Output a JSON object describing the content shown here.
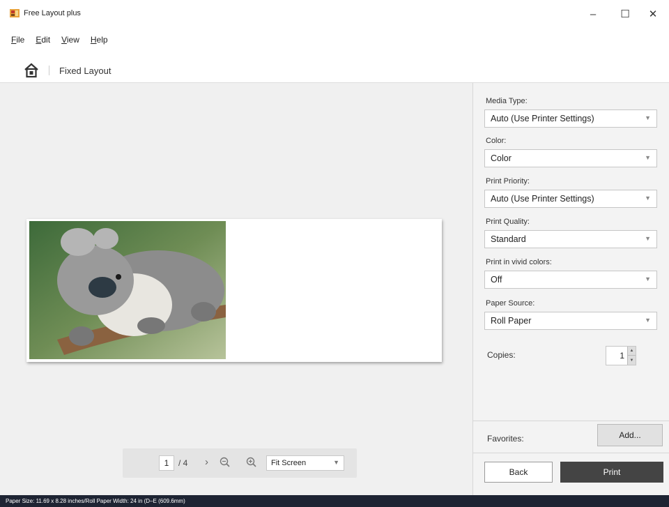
{
  "window": {
    "title": "Free Layout plus",
    "minimize_glyph": "–",
    "maximize_glyph": "☐",
    "close_glyph": "✕"
  },
  "menu": {
    "items": [
      "File",
      "Edit",
      "View",
      "Help"
    ]
  },
  "breadcrumb": {
    "home_icon": "home-icon",
    "current": "Fixed Layout"
  },
  "pager": {
    "current_page": "1",
    "total": "/ 4",
    "next_glyph": "›",
    "zoom_value": "Fit Screen"
  },
  "settings": {
    "media_type": {
      "label": "Media Type:",
      "value": "Auto (Use Printer Settings)"
    },
    "color": {
      "label": "Color:",
      "value": "Color"
    },
    "print_priority": {
      "label": "Print Priority:",
      "value": "Auto (Use Printer Settings)"
    },
    "print_quality": {
      "label": "Print Quality:",
      "value": "Standard"
    },
    "vivid_colors": {
      "label": "Print in vivid colors:",
      "value": "Off"
    },
    "paper_source": {
      "label": "Paper Source:",
      "value": "Roll Paper"
    },
    "copies": {
      "label": "Copies:",
      "value": "1"
    }
  },
  "favorites": {
    "label": "Favorites:",
    "add_label": "Add..."
  },
  "actions": {
    "back_label": "Back",
    "print_label": "Print"
  },
  "status": {
    "text": "Paper Size: 11.69 x 8.28 inches/Roll Paper Width: 24 in (D–E (609.6mm)"
  },
  "colors": {
    "print_button": "#444444",
    "status_bar": "#1e2433",
    "preview_bg": "#f0f0f0"
  }
}
